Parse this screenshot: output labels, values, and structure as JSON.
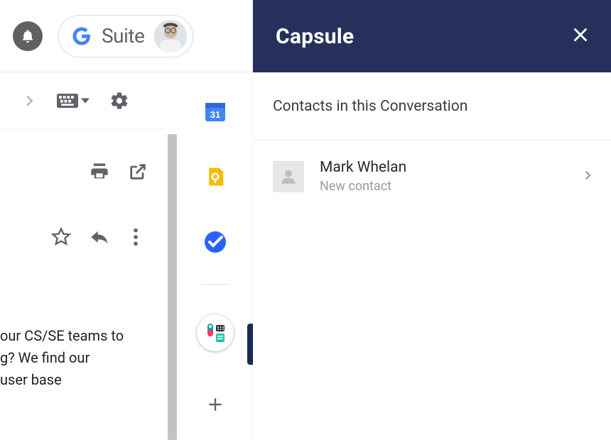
{
  "header": {
    "suite_label": "Suite"
  },
  "rail": {
    "calendar_day": "31"
  },
  "panel": {
    "title": "Capsule",
    "section_title": "Contacts in this Conversation",
    "contacts": [
      {
        "name": "Mark Whelan",
        "subtitle": "New contact"
      }
    ]
  },
  "email_body": {
    "line1": "our CS/SE teams to",
    "line2": "g? We find our",
    "line3": "user base"
  }
}
